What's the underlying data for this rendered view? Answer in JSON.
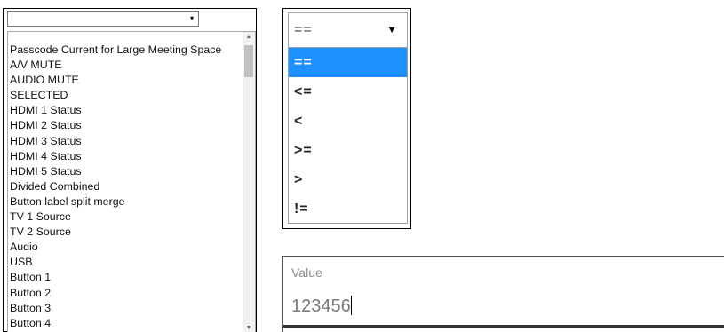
{
  "left_select": {
    "selected_value": "",
    "caret_icon": "▾",
    "items": [
      "Passcode Current for Large Meeting Space",
      "A/V MUTE",
      "AUDIO MUTE",
      "SELECTED",
      "HDMI 1 Status",
      "HDMI 2 Status",
      "HDMI 3 Status",
      "HDMI 4 Status",
      "HDMI 5 Status",
      "Divided Combined",
      "Button label split merge",
      "TV 1 Source",
      "TV 2 Source",
      "Audio",
      "USB",
      "Button 1",
      "Button 2",
      "Button 3",
      "Button 4"
    ],
    "scroll_up_icon": "▲",
    "scroll_down_icon": "▼"
  },
  "operator_select": {
    "selected_value": "==",
    "caret_icon": "▼",
    "options": [
      "==",
      "<=",
      "<",
      ">=",
      ">",
      "!="
    ],
    "selected_index": 0,
    "highlight_color": "#1e90ff"
  },
  "value_field": {
    "label": "Value",
    "value": "123456"
  }
}
